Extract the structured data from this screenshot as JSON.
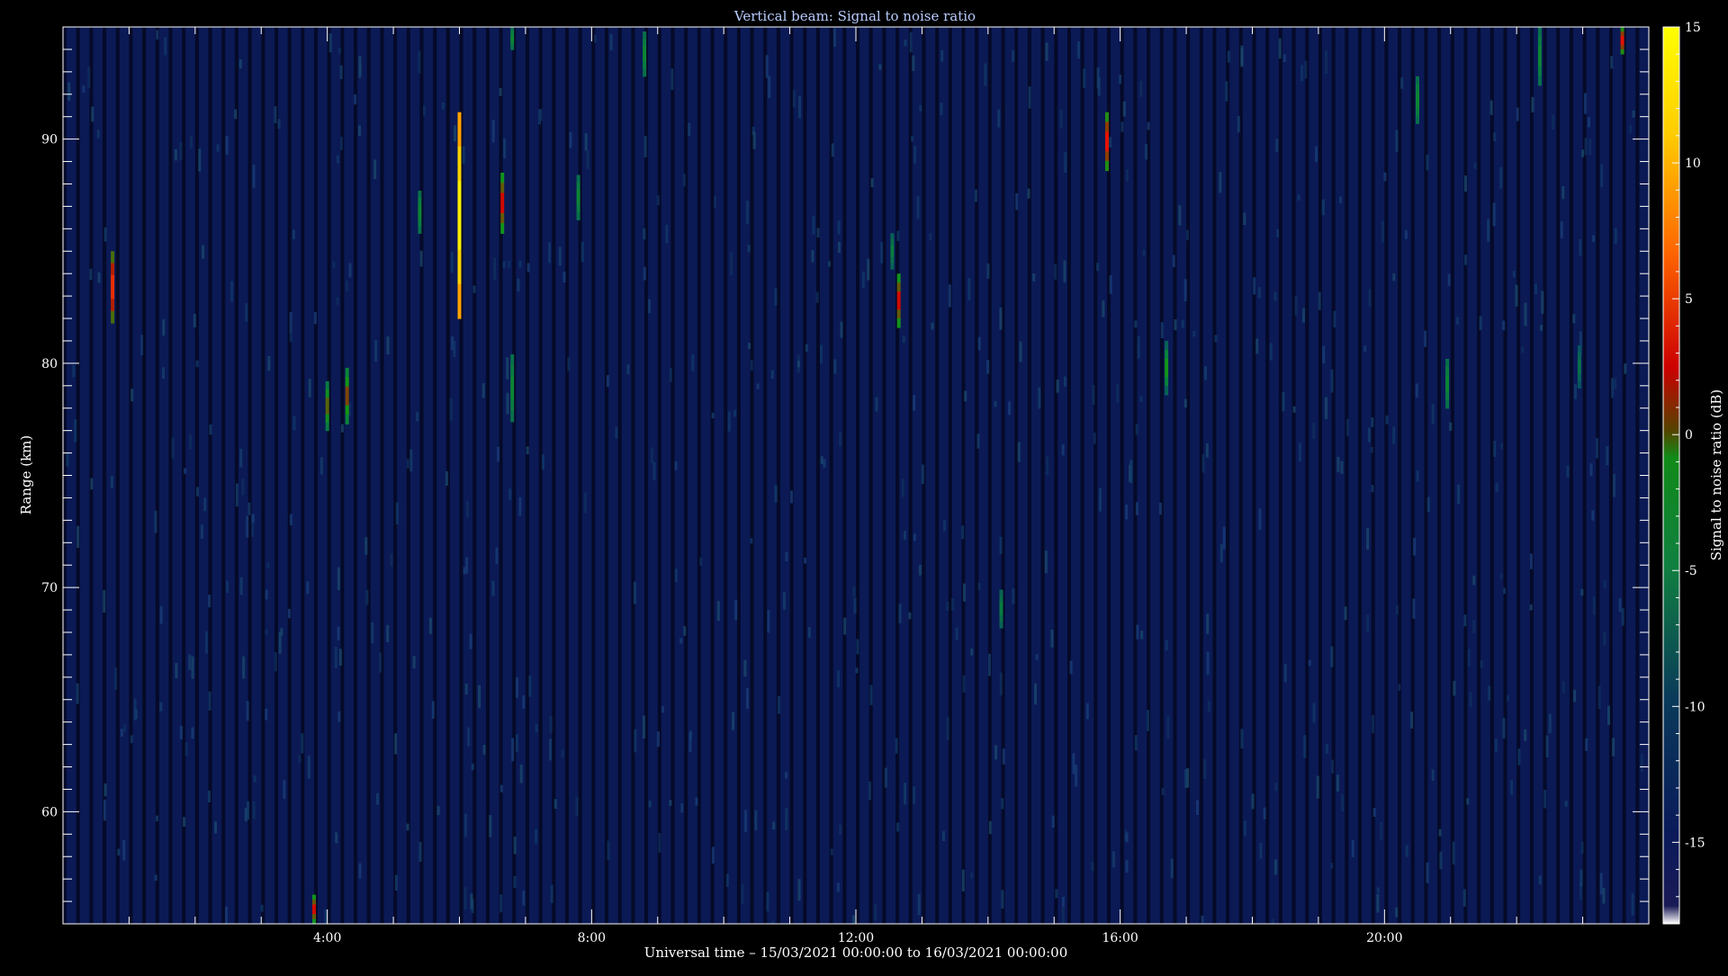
{
  "chart_data": {
    "type": "heatmap",
    "title": "Vertical beam: Signal to noise ratio",
    "xlabel": "Universal time – 15/03/2021 00:00:00 to 16/03/2021 00:00:00",
    "ylabel": "Range (km)",
    "colorbar_label": "Signal to noise ratio (dB)",
    "x_unit": "hours UT",
    "xlim": [
      0,
      24
    ],
    "ylim": [
      55,
      95
    ],
    "x_ticks": [
      "4:00",
      "8:00",
      "12:00",
      "16:00",
      "20:00"
    ],
    "y_ticks": [
      "60",
      "70",
      "80",
      "90"
    ],
    "colorbar_ticks": [
      "15",
      "10",
      "5",
      "0",
      "-5",
      "-10",
      "-15"
    ],
    "colorbar_range": [
      -18,
      15
    ],
    "background_snr": -15,
    "features": [
      {
        "t": 0.75,
        "r0": 81.8,
        "r1": 85.0,
        "snr": 5
      },
      {
        "t": 3.8,
        "r0": 55.0,
        "r1": 56.3,
        "snr": 3
      },
      {
        "t": 4.0,
        "r0": 77.0,
        "r1": 79.2,
        "snr": 0
      },
      {
        "t": 4.3,
        "r0": 77.3,
        "r1": 79.8,
        "snr": 1
      },
      {
        "t": 5.4,
        "r0": 85.8,
        "r1": 87.7,
        "snr": -5
      },
      {
        "t": 6.0,
        "r0": 82.0,
        "r1": 91.2,
        "snr": 15
      },
      {
        "t": 6.65,
        "r0": 85.8,
        "r1": 88.5,
        "snr": 3
      },
      {
        "t": 6.8,
        "r0": 77.4,
        "r1": 80.4,
        "snr": -5
      },
      {
        "t": 6.8,
        "r0": 94.0,
        "r1": 95.0,
        "snr": -5
      },
      {
        "t": 7.8,
        "r0": 86.4,
        "r1": 88.4,
        "snr": -5
      },
      {
        "t": 8.8,
        "r0": 92.8,
        "r1": 94.8,
        "snr": -5
      },
      {
        "t": 12.55,
        "r0": 84.2,
        "r1": 85.8,
        "snr": -6
      },
      {
        "t": 12.65,
        "r0": 81.6,
        "r1": 84.0,
        "snr": 3
      },
      {
        "t": 14.2,
        "r0": 68.2,
        "r1": 69.9,
        "snr": -6
      },
      {
        "t": 15.8,
        "r0": 88.6,
        "r1": 91.2,
        "snr": 4
      },
      {
        "t": 16.7,
        "r0": 78.6,
        "r1": 81.0,
        "snr": -2
      },
      {
        "t": 20.5,
        "r0": 90.7,
        "r1": 92.8,
        "snr": -5
      },
      {
        "t": 20.95,
        "r0": 78.0,
        "r1": 80.2,
        "snr": -5
      },
      {
        "t": 22.35,
        "r0": 92.4,
        "r1": 95.0,
        "snr": -5
      },
      {
        "t": 22.95,
        "r0": 78.9,
        "r1": 80.8,
        "snr": -7
      },
      {
        "t": 23.6,
        "r0": 93.8,
        "r1": 95.0,
        "snr": 4
      }
    ]
  }
}
